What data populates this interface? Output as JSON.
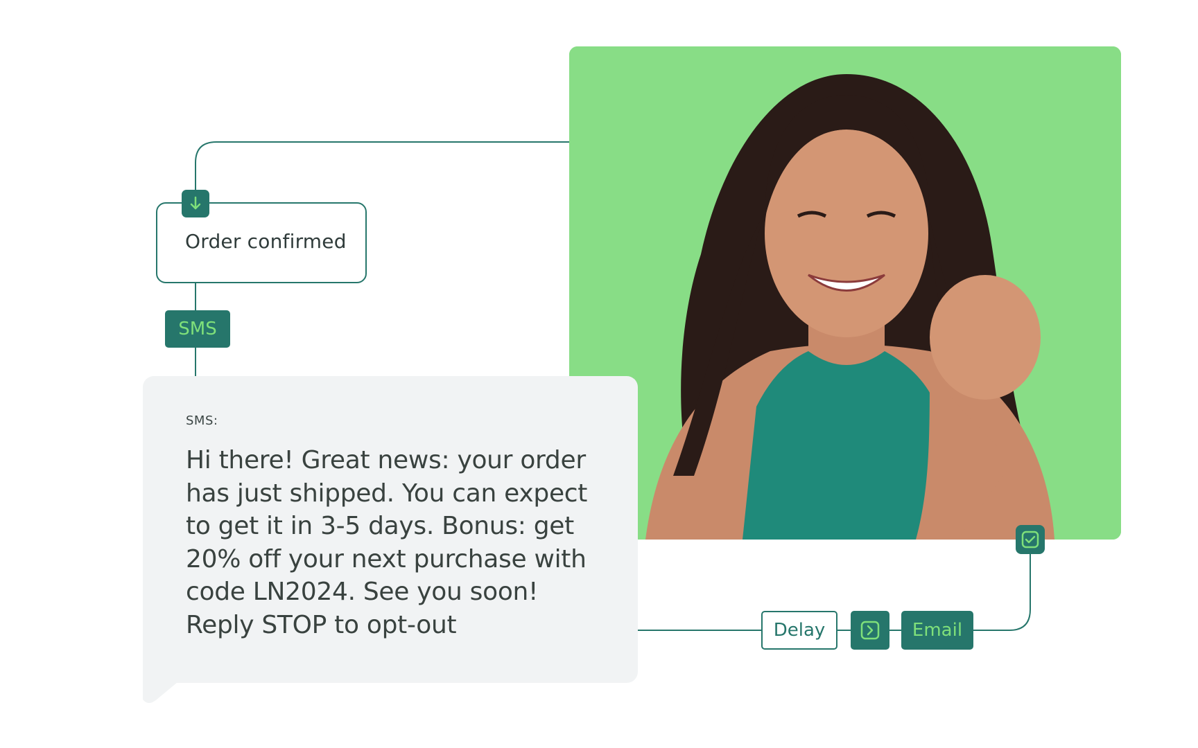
{
  "flow": {
    "trigger": {
      "label": "Order confirmed",
      "icon": "arrow-down-icon"
    },
    "channel_tag": {
      "label": "SMS"
    },
    "message": {
      "kicker": "SMS:",
      "body": "Hi there! Great news: your order has just shipped. You can expect to get it in 3-5 days. Bonus: get 20% off your next purchase with code LN2024. See you soon! Reply STOP to opt-out"
    },
    "delay": {
      "label": "Delay"
    },
    "next": {
      "icon": "chevron-right-icon"
    },
    "email": {
      "label": "Email"
    },
    "check": {
      "icon": "checkbox-checked-icon"
    }
  },
  "photo": {
    "subject": "smiling woman in teal top on green background",
    "background_color": "#88dd86"
  },
  "colors": {
    "accent": "#26766b",
    "highlight": "#7fe07a",
    "bubble": "#f1f3f4",
    "text": "#39423f"
  }
}
